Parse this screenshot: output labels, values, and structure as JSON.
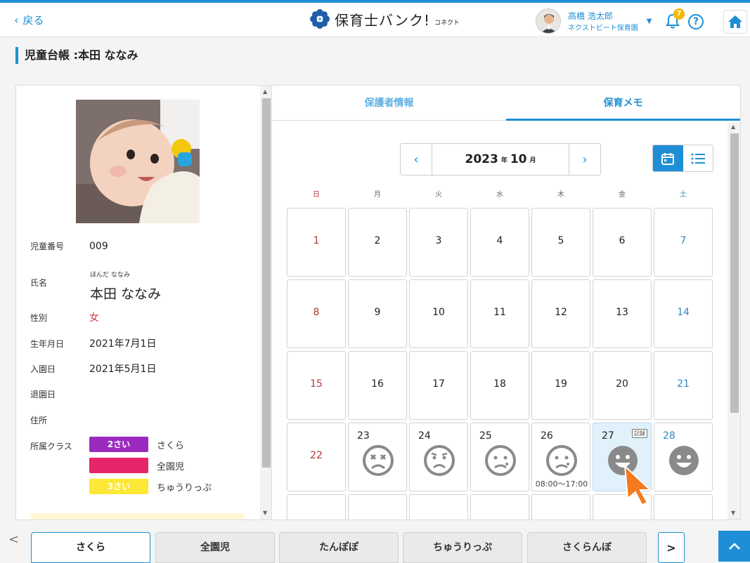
{
  "header": {
    "back_label": "戻る",
    "logo_text": "保育士バンク!",
    "logo_sub": "コネクト",
    "user_name": "高橋 浩太郎",
    "user_org": "ネクストビート保育園",
    "notification_count": "7",
    "help_label": "?"
  },
  "page": {
    "title": "児童台帳 :本田 ななみ"
  },
  "child": {
    "number_label": "児童番号",
    "number": "009",
    "name_label": "氏名",
    "furigana": "ほんだ ななみ",
    "name": "本田 ななみ",
    "gender_label": "性別",
    "gender": "女",
    "birth_label": "生年月日",
    "birth": "2021年7月1日",
    "enroll_label": "入園日",
    "enroll": "2021年5月1日",
    "leave_label": "退園日",
    "leave": "",
    "address_label": "住所",
    "address": "",
    "class_label": "所属クラス",
    "classes": [
      {
        "pill": "2さい",
        "name": "さくら",
        "color": "#9b2bbf"
      },
      {
        "pill": "",
        "name": "全園児",
        "color": "#e8246a"
      },
      {
        "pill": "3さい",
        "name": "ちゅうりっぷ",
        "color": "#fde737"
      }
    ]
  },
  "tabs": {
    "guardian": "保護者情報",
    "memo": "保育メモ"
  },
  "calendar": {
    "year": "2023",
    "year_unit": "年",
    "month": "10",
    "month_unit": "月",
    "prev": "‹",
    "next": "›",
    "weekdays": [
      "日",
      "月",
      "火",
      "水",
      "木",
      "金",
      "土"
    ],
    "rows": [
      [
        "1",
        "2",
        "3",
        "4",
        "5",
        "6",
        "7"
      ],
      [
        "8",
        "9",
        "10",
        "11",
        "12",
        "13",
        "14"
      ],
      [
        "15",
        "16",
        "17",
        "18",
        "19",
        "20",
        "21"
      ],
      [
        "22",
        "23",
        "24",
        "25",
        "26",
        "27",
        "28"
      ]
    ],
    "moods": {
      "23": "dizzy",
      "24": "sad",
      "25": "unwell",
      "26": "unwell",
      "27": "happy",
      "28": "happy"
    },
    "time_26": "08:00〜17:00",
    "record_badge": "記録"
  },
  "bottom_tabs": [
    "さくら",
    "全園児",
    "たんぽぽ",
    "ちゅうりっぷ",
    "さくらんぼ"
  ],
  "bottom_nav": {
    "prev": "<",
    "next": ">"
  },
  "colors": {
    "accent": "#1e8fd6"
  }
}
